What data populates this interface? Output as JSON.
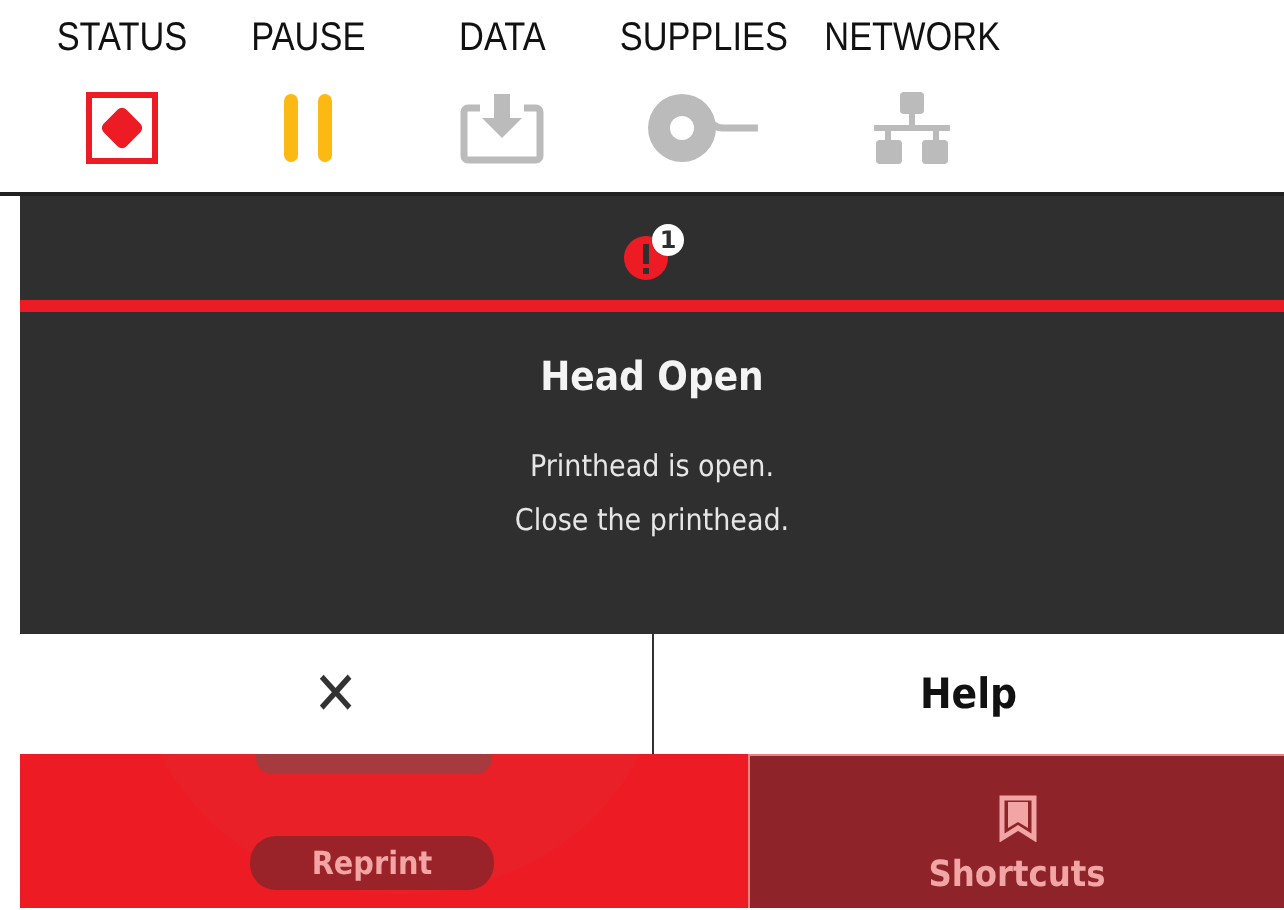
{
  "indicators": [
    {
      "label": "STATUS",
      "kind": "status",
      "color": "#ed1c24"
    },
    {
      "label": "PAUSE",
      "kind": "pause",
      "color": "#fdb913"
    },
    {
      "label": "DATA",
      "kind": "data",
      "color": "#bbbbbb"
    },
    {
      "label": "SUPPLIES",
      "kind": "supplies",
      "color": "#bbbbbb"
    },
    {
      "label": "NETWORK",
      "kind": "network",
      "color": "#bbbbbb"
    }
  ],
  "alert": {
    "badge": "1",
    "title": "Head Open",
    "message_lines": [
      "Printhead is open.",
      "Close the printhead."
    ],
    "close_button": "✕",
    "help_button": "Help"
  },
  "home": {
    "reprint_button": "Reprint",
    "shortcuts_button": "Shortcuts"
  }
}
